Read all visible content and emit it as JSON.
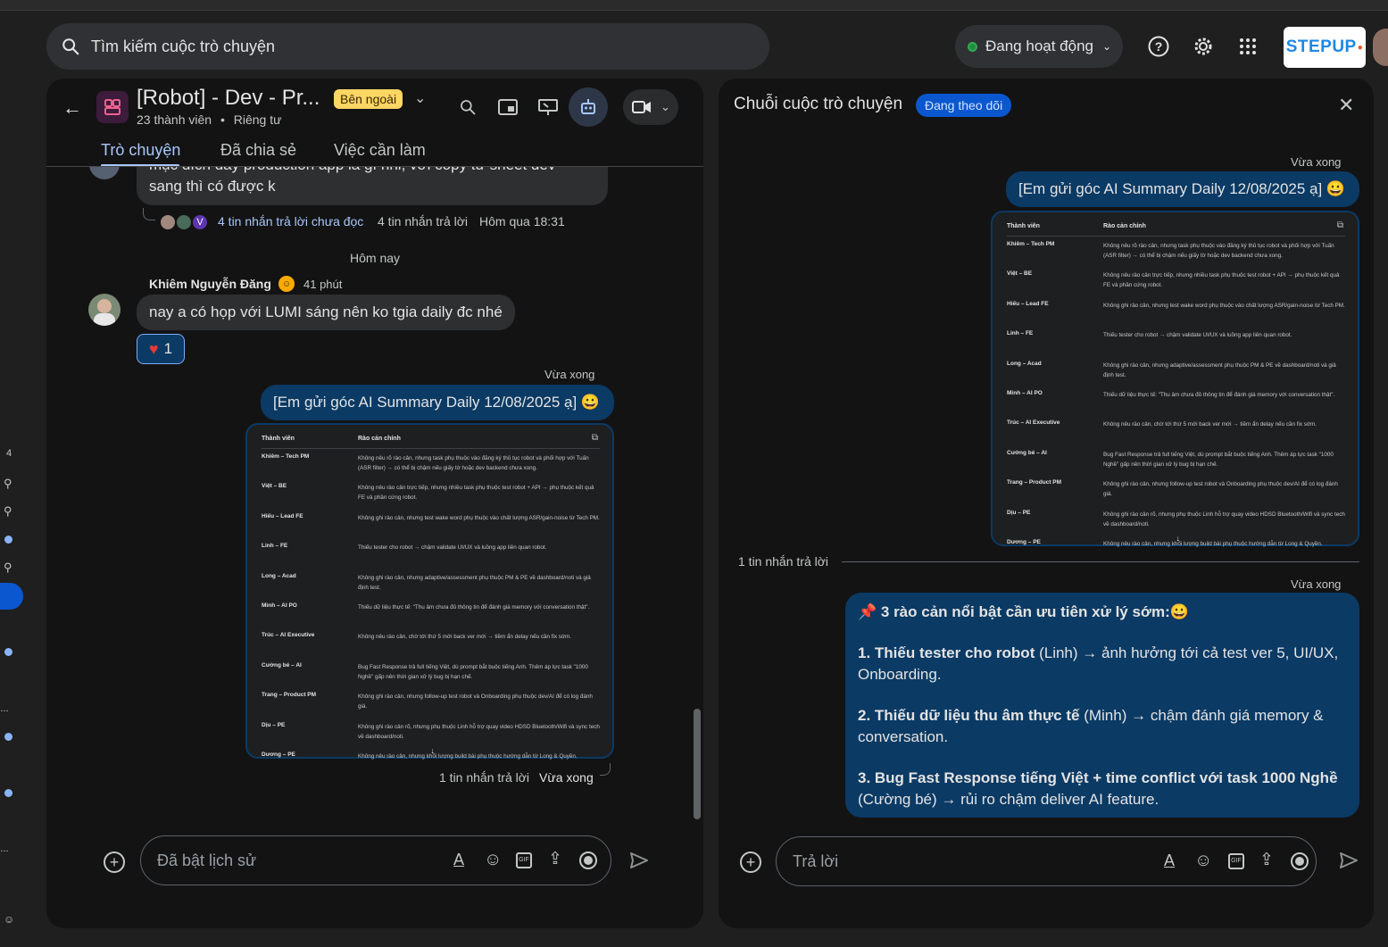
{
  "top": {
    "search_placeholder": "Tìm kiếm cuộc trò chuyện",
    "status_label": "Đang hoạt động",
    "brand_text": "STEPUP"
  },
  "rail": {
    "count": "4",
    "dots": "...",
    "dots2": "..."
  },
  "space": {
    "title": "[Robot] - Dev - Pr...",
    "external_badge": "Bên ngoài",
    "members": "23 thành viên",
    "privacy": "Riêng tư",
    "tabs": [
      "Trò chuyện",
      "Đã chia sẻ",
      "Việc cần làm"
    ]
  },
  "chat": {
    "prev_msg_partial": "mục đích dày production app là gì nhỉ, với copy từ sheet dev",
    "prev_msg_line2": "sang thì có được k",
    "prev_avatar_letter": "V",
    "prev_unread": "4 tin nhắn trả lời chưa đọc",
    "prev_replies": "4 tin nhắn trả lời",
    "prev_time": "Hôm qua 18:31",
    "date_divider": "Hôm nay",
    "sender": "Khiêm Nguyễn Đăng",
    "sender_time": "41 phút",
    "sender_msg": "nay a có họp với LUMI sáng nên ko tgia daily đc nhé",
    "reaction_count": "1",
    "my_time": "Vừa xong",
    "my_msg": "[Em gửi góc AI Summary Daily 12/08/2025 ạ] 😀",
    "my_footer_replies": "1 tin nhắn trả lời",
    "my_footer_time": "Vừa xong",
    "composer_placeholder": "Đã bật lịch sử"
  },
  "table": {
    "header_name": "Thành viên",
    "header_desc": "Rào cản chính",
    "rows": [
      {
        "name": "Khiêm – Tech PM",
        "desc": "Không nêu rõ rào cản, nhưng task phụ thuộc vào đăng ký thủ tục robot và phối hợp với Tuấn (ASR filter) → có thể bị chậm nếu giấy tờ hoặc dev backend chưa xong."
      },
      {
        "name": "Việt – BE",
        "desc": "Không nêu rào cản trực tiếp, nhưng nhiều task phụ thuộc test robot + API → phụ thuộc kết quả FE và phần cứng robot."
      },
      {
        "name": "Hiếu – Lead FE",
        "desc": "Không ghi rào cản, nhưng test wake word phụ thuộc vào chất lượng ASR/gain-noise từ Tech PM."
      },
      {
        "name": "Linh – FE",
        "desc": "Thiếu tester cho robot → chậm validate UI/UX và luồng app liên quan robot."
      },
      {
        "name": "Long – Acad",
        "desc": "Không ghi rào cản, nhưng adaptive/assessment phụ thuộc PM & PE về dashboard/noti và giả định test."
      },
      {
        "name": "Minh – AI PO",
        "desc": "Thiếu dữ liệu thực tế: \"Thu âm chưa đủ thông tin để đánh giá memory với conversation thật\"."
      },
      {
        "name": "Trúc – AI Executive",
        "desc": "Không nêu rào cản, chờ tới thứ 5 mới back ver mới → tiềm ẩn delay nếu cần fix sớm."
      },
      {
        "name": "Cường bé – AI",
        "desc": "Bug Fast Response trả full tiếng Việt, dù prompt bắt buộc tiếng Anh. Thêm áp lực task \"1000 Nghề\" gấp nên thời gian xử lý bug bị hạn chế."
      },
      {
        "name": "Trang – Product PM",
        "desc": "Không ghi rào cản, nhưng follow-up test robot và Onboarding phụ thuộc dev/AI để có log đánh giá."
      },
      {
        "name": "Dịu – PE",
        "desc": "Không ghi rào cản rõ, nhưng phụ thuộc Linh hỗ trợ quay video HDSD Bluetooth/Wifi và sync tech về dashboard/noti."
      },
      {
        "name": "Dương – PE",
        "desc": "Không nêu rào cản, nhưng khối lượng build bài phụ thuộc hướng dẫn từ Long & Quyền."
      }
    ]
  },
  "thread": {
    "title": "Chuỗi cuộc trò chuyện",
    "following_badge": "Đang theo dõi",
    "first_time": "Vừa xong",
    "first_msg": "[Em gửi góc AI Summary Daily 12/08/2025 ạ] 😀",
    "reply_divider": "1 tin nhắn trả lời",
    "reply_time": "Vừa xong",
    "reply_heading": "📌 3 rào cản nổi bật cần ưu tiên xử lý sớm:😀",
    "reply_items": [
      {
        "bold": "1. Thiếu tester cho robot",
        "rest": " (Linh) → ảnh hưởng tới cả test ver 5, UI/UX, Onboarding."
      },
      {
        "bold": "2. Thiếu dữ liệu thu âm thực tế",
        "rest": " (Minh) → chậm đánh giá memory & conversation."
      },
      {
        "bold": "3. Bug Fast Response tiếng Việt + time conflict với task 1000 Nghề",
        "rest": " (Cường bé) → rủi ro chậm deliver AI feature."
      }
    ],
    "composer_placeholder": "Trả lời"
  }
}
